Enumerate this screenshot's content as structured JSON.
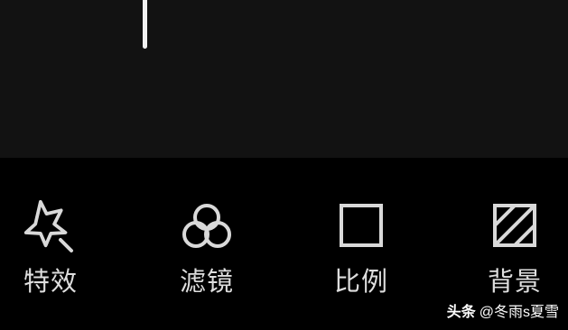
{
  "toolbar": {
    "items": [
      {
        "label": "特效",
        "icon": "star-wand-icon"
      },
      {
        "label": "滤镜",
        "icon": "filter-circles-icon"
      },
      {
        "label": "比例",
        "icon": "aspect-ratio-square-icon"
      },
      {
        "label": "背景",
        "icon": "background-hatch-icon"
      }
    ]
  },
  "watermark": {
    "brand": "头条",
    "handle": "@冬雨s夏雪"
  },
  "colors": {
    "timeline_bg": "#121212",
    "toolbar_bg": "#000000",
    "icon_stroke": "#d9d9d9",
    "playhead": "#f2f2f2"
  }
}
